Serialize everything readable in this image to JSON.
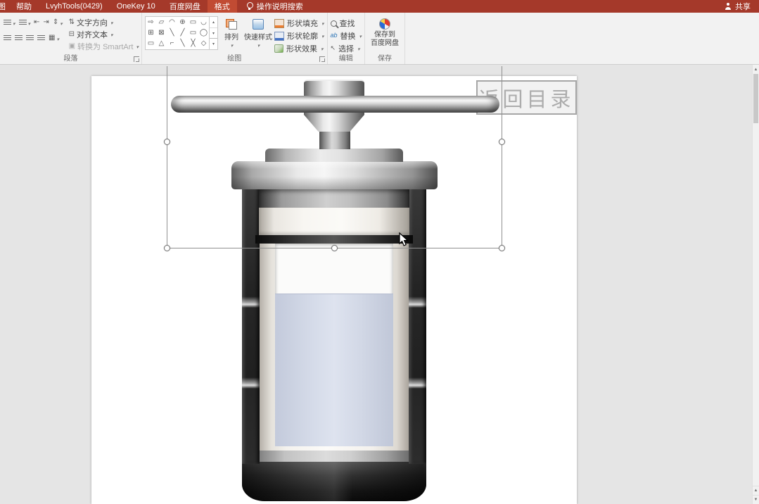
{
  "colors": {
    "titlebar": "#A5392A",
    "active_tab": "#C14B33",
    "fill_accent": "#ED7D31",
    "outline_accent": "#4472C4",
    "effects_accent": "#70AD47",
    "liquid": "#D2D8E7"
  },
  "titlebar": {
    "partial_tab": "图",
    "tabs": [
      "帮助",
      "LvyhTools(0429)",
      "OneKey 10",
      "百度网盘"
    ],
    "active_tab": "格式",
    "tellme": "操作说明搜索",
    "share": "共享"
  },
  "ribbon": {
    "paragraph": {
      "text_direction": "文字方向",
      "align_text": "对齐文本",
      "smartart": "转换为 SmartArt",
      "group_label": "段落"
    },
    "drawing": {
      "shapes": [
        "⇨",
        "▱",
        "◠",
        "⊕",
        "▭",
        "◡",
        "⊞",
        "⊠",
        "╲",
        "╱",
        "▭",
        "◯",
        "▭",
        "△",
        "⌐",
        "╲",
        "╳",
        "◇"
      ],
      "arrange": "排列",
      "quick_styles": "快速样式",
      "shape_fill": "形状填充",
      "shape_outline": "形状轮廓",
      "shape_effects": "形状效果",
      "group_label": "绘图"
    },
    "editing": {
      "find": "查找",
      "replace": "替换",
      "select": "选择",
      "group_label": "编辑"
    },
    "save": {
      "line1": "保存到",
      "line2": "百度网盘",
      "group_label": "保存"
    }
  },
  "slide": {
    "back_button": "返回目录"
  }
}
